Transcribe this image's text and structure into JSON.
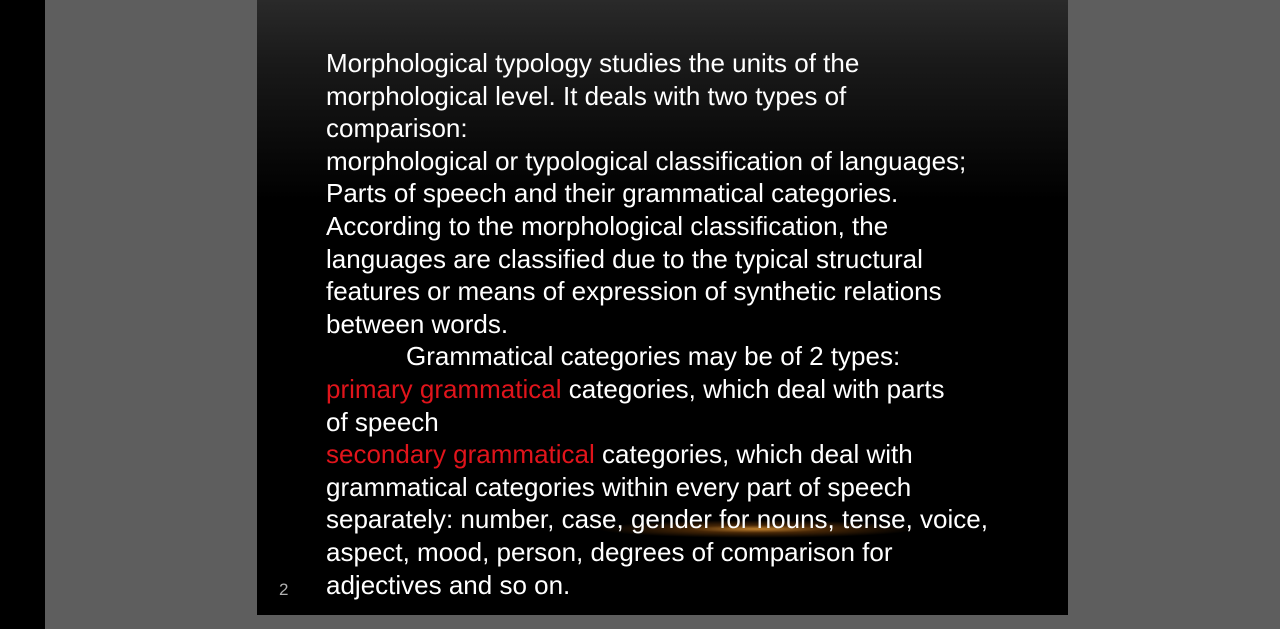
{
  "slide": {
    "page_number": "2",
    "lines": [
      "Morphological typology studies the units of the",
      "morphological level. It deals with two types of",
      "comparison:",
      "morphological or typological classification of languages;",
      "Parts of speech and their grammatical categories.",
      "According to the morphological classification, the",
      "languages are classified due to the typical structural",
      "features or means of expression of synthetic relations",
      "between words.",
      "Grammatical categories may be of 2 types:"
    ],
    "primary": {
      "highlight": "primary grammatical",
      "rest": " categories, which deal with parts",
      "cont": "of speech"
    },
    "secondary": {
      "highlight": "secondary grammatical",
      "rest": " categories, which deal with",
      "cont": [
        "grammatical categories within every part of speech",
        "separately: number, case, gender for nouns, tense, voice,",
        "aspect, mood, person, degrees of comparison for",
        "adjectives and so on."
      ]
    },
    "highlight_color": "#e0141b",
    "text_color": "#ffffff"
  }
}
